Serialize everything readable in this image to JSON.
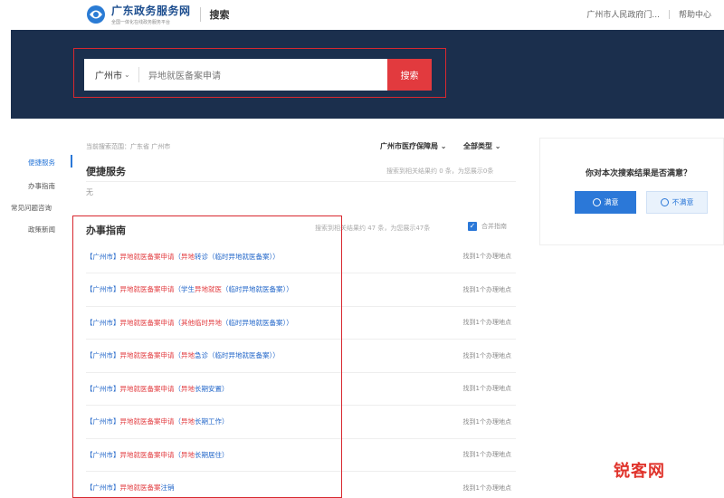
{
  "header": {
    "site_title": "广东政务服务网",
    "site_subtitle": "全国一体化在线政务服务平台",
    "section": "搜索",
    "links": [
      "广州市人民政府门...",
      "帮助中心"
    ]
  },
  "search": {
    "city": "广州市",
    "query": "异地就医备案申请",
    "button": "搜索"
  },
  "leftnav": {
    "items": [
      {
        "label": "便捷服务",
        "active": true
      },
      {
        "label": "办事指南",
        "active": false
      },
      {
        "label": "常见问题咨询",
        "active": false
      },
      {
        "label": "政策新闻",
        "active": false
      }
    ]
  },
  "results": {
    "scope": "当前搜索范围：广东省 广州市",
    "filters": [
      "广州市医疗保障局",
      "全部类型"
    ],
    "convenience": {
      "title": "便捷服务",
      "meta": "搜索到相关结果约 0 条，为您展示0条",
      "empty": "无"
    },
    "guide": {
      "title": "办事指南",
      "meta": "搜索到相关结果约 47 条，为您展示47条",
      "merge_label": "合并指南",
      "items": [
        {
          "prefix": "【广州市】",
          "hl1": "异地就医备案申请",
          "mid": "（",
          "hl2": "异地",
          "tail": "转诊（临时异地就医备案））",
          "count": "找到1个办理地点"
        },
        {
          "prefix": "【广州市】",
          "hl1": "异地就医备案申请",
          "mid": "（学生",
          "hl2": "异地就医",
          "tail": "（临时异地就医备案））",
          "count": "找到1个办理地点"
        },
        {
          "prefix": "【广州市】",
          "hl1": "异地就医备案申请",
          "mid": "（",
          "hl2": "其他临时异地",
          "tail": "（临时异地就医备案））",
          "count": "找到1个办理地点"
        },
        {
          "prefix": "【广州市】",
          "hl1": "异地就医备案申请",
          "mid": "（",
          "hl2": "异地",
          "tail": "急诊（临时异地就医备案））",
          "count": "找到1个办理地点"
        },
        {
          "prefix": "【广州市】",
          "hl1": "异地就医备案申请",
          "mid": "（",
          "hl2": "异地",
          "tail": "长期安置）",
          "count": "找到1个办理地点"
        },
        {
          "prefix": "【广州市】",
          "hl1": "异地就医备案申请",
          "mid": "（",
          "hl2": "异地",
          "tail": "长期工作）",
          "count": "找到1个办理地点"
        },
        {
          "prefix": "【广州市】",
          "hl1": "异地就医备案申请",
          "mid": "（",
          "hl2": "异地",
          "tail": "长期居住）",
          "count": "找到1个办理地点"
        },
        {
          "prefix": "【广州市】",
          "hl1": "异地就医备案",
          "mid": "",
          "hl2": "",
          "tail": "注销",
          "count": "找到1个办理地点"
        }
      ]
    }
  },
  "survey": {
    "question": "你对本次搜索结果是否满意？",
    "yes": "满意",
    "no": "不满意"
  },
  "watermark": "锐客网",
  "colors": {
    "banner": "#1b2f4d",
    "accent_red": "#e23a3e",
    "link_blue": "#1f64c8",
    "primary_blue": "#2b78d8"
  }
}
